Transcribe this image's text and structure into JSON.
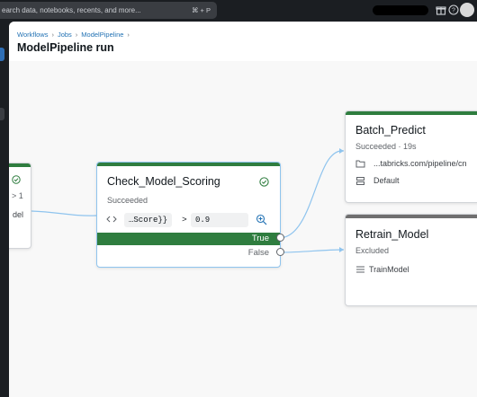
{
  "topbar": {
    "search_placeholder": "earch data, notebooks, recents, and more...",
    "search_shortcut": "⌘ + P"
  },
  "breadcrumb": [
    "Workflows",
    "Jobs",
    "ModelPipeline"
  ],
  "page_title": "ModelPipeline run",
  "nodes": {
    "partial_left": {
      "line1": "> 1",
      "line2": "del"
    },
    "check_model_scoring": {
      "title": "Check_Model_Scoring",
      "status": "Succeeded",
      "left_operand": "…Score}}",
      "operator": ">",
      "right_operand": "0.9",
      "true_label": "True",
      "false_label": "False"
    },
    "batch_predict": {
      "title": "Batch_Predict",
      "status": "Succeeded · 19s",
      "path": "...tabricks.com/pipeline/cn",
      "cluster": "Default"
    },
    "retrain_model": {
      "title": "Retrain_Model",
      "status": "Excluded",
      "task": "TrainModel"
    }
  },
  "colors": {
    "success": "#2f7d3f",
    "excluded": "#6f6f6f",
    "link": "#2272b4",
    "edge": "#8fc4ee"
  },
  "icons": [
    "gift-icon",
    "help-icon",
    "grid-icon",
    "success-check-icon",
    "zoom-icon",
    "folder-icon",
    "cluster-icon",
    "task-icon"
  ]
}
